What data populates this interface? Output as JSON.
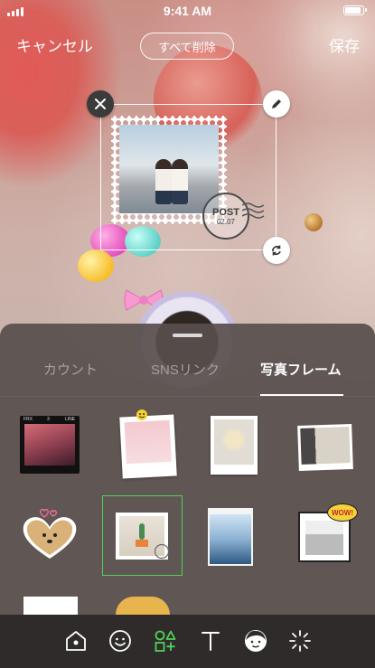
{
  "status_bar": {
    "time": "9:41 AM"
  },
  "top_bar": {
    "cancel_label": "キャンセル",
    "delete_all_label": "すべて削除",
    "save_label": "保存"
  },
  "sticker": {
    "postmark_text": "POST",
    "postmark_date": "02.07"
  },
  "sheet": {
    "tabs": [
      {
        "label": "カウント",
        "selected": false
      },
      {
        "label": "SNSリンク",
        "selected": false
      },
      {
        "label": "写真フレーム",
        "selected": true
      }
    ],
    "frames": [
      {
        "icon": "film-frame",
        "selected": false,
        "film_labels": [
          "FRX",
          "3",
          "LINE"
        ]
      },
      {
        "icon": "polaroid-frame",
        "selected": false
      },
      {
        "icon": "white-border-frame",
        "selected": false
      },
      {
        "icon": "torn-paper-frame",
        "selected": false
      },
      {
        "icon": "heart-frame",
        "selected": false
      },
      {
        "icon": "postage-stamp-frame",
        "selected": true
      },
      {
        "icon": "phone-screen-frame",
        "selected": false
      },
      {
        "icon": "comic-frame",
        "selected": false,
        "badge": "WOW!"
      }
    ]
  },
  "toolbar": {
    "tools": [
      {
        "icon": "home-sticker-icon",
        "selected": false
      },
      {
        "icon": "emoji-icon",
        "selected": false
      },
      {
        "icon": "shapes-add-icon",
        "selected": true
      },
      {
        "icon": "text-icon",
        "selected": false
      },
      {
        "icon": "avatar-icon",
        "selected": false
      },
      {
        "icon": "effects-icon",
        "selected": false
      }
    ],
    "accent_color": "#4fd15a"
  }
}
